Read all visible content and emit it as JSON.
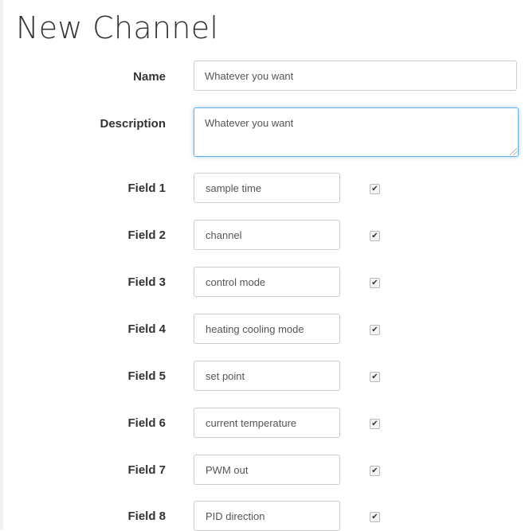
{
  "page": {
    "title": "New Channel"
  },
  "form": {
    "name": {
      "label": "Name",
      "value": "Whatever you want"
    },
    "description": {
      "label": "Description",
      "value": "Whatever you want"
    },
    "fields": [
      {
        "label": "Field 1",
        "value": "sample time",
        "checked": true
      },
      {
        "label": "Field 2",
        "value": "channel",
        "checked": true
      },
      {
        "label": "Field 3",
        "value": "control mode",
        "checked": true
      },
      {
        "label": "Field 4",
        "value": "heating cooling mode",
        "checked": true
      },
      {
        "label": "Field 5",
        "value": "set point",
        "checked": true
      },
      {
        "label": "Field 6",
        "value": "current temperature",
        "checked": true
      },
      {
        "label": "Field 7",
        "value": "PWM out",
        "checked": true
      },
      {
        "label": "Field 8",
        "value": "PID direction",
        "checked": true
      }
    ]
  },
  "colors": {
    "focus_border": "#66afe9",
    "input_border": "#cccccc",
    "label_text": "#333333"
  },
  "icons": {
    "checkbox_mark": "checkmark-icon"
  }
}
